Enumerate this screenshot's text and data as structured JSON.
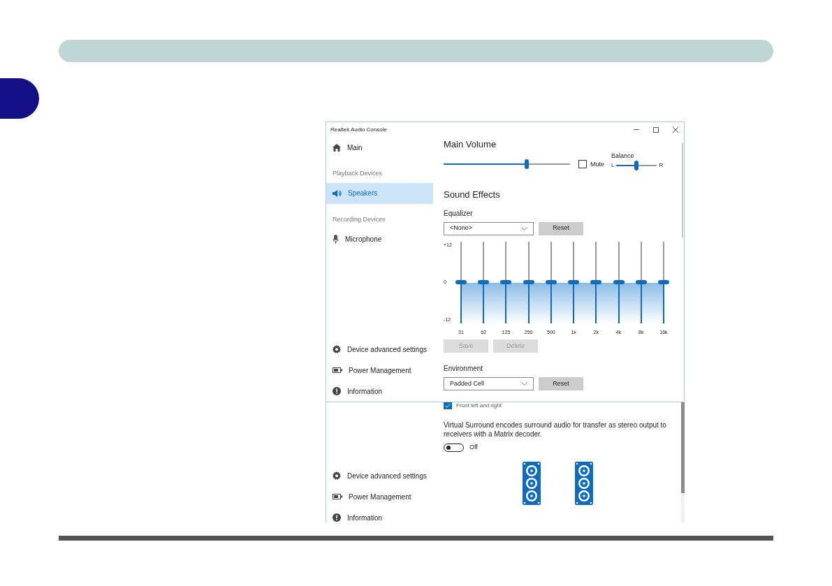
{
  "window": {
    "title": "Realtek Audio Console"
  },
  "sidebar": {
    "items": [
      {
        "kind": "nav",
        "label": "Main",
        "selected": false
      },
      {
        "kind": "header",
        "label": "Playback Devices"
      },
      {
        "kind": "nav",
        "label": "Speakers",
        "selected": true
      },
      {
        "kind": "header",
        "label": "Recording Devices"
      },
      {
        "kind": "nav",
        "label": "Microphone",
        "selected": false
      }
    ],
    "footer": [
      "Device advanced settings",
      "Power Management",
      "Information"
    ]
  },
  "main_volume": {
    "title": "Main Volume",
    "level": 0.66,
    "mute": {
      "label": "Mute",
      "checked": false
    },
    "balance": {
      "label": "Balance",
      "left": "L",
      "right": "R",
      "level": 0.5
    }
  },
  "sound_effects": {
    "title": "Sound Effects",
    "equalizer": {
      "label": "Equalizer",
      "preset": "<None>",
      "reset": "Reset",
      "scale": [
        "+12",
        "0",
        "-12"
      ],
      "bands": [
        {
          "label": "31",
          "level": 0.5
        },
        {
          "label": "62",
          "level": 0.5
        },
        {
          "label": "125",
          "level": 0.5
        },
        {
          "label": "250",
          "level": 0.5
        },
        {
          "label": "500",
          "level": 0.5
        },
        {
          "label": "1k",
          "level": 0.5
        },
        {
          "label": "2k",
          "level": 0.5
        },
        {
          "label": "4k",
          "level": 0.5
        },
        {
          "label": "8k",
          "level": 0.5
        },
        {
          "label": "16k",
          "level": 0.5
        }
      ],
      "save": {
        "label": "Save",
        "disabled": true
      },
      "delete": {
        "label": "Delete",
        "disabled": true
      }
    },
    "environment": {
      "label": "Environment",
      "value": "Padded Cell",
      "reset": "Reset"
    }
  },
  "lower_pane": {
    "front": {
      "label": "Front left and right",
      "checked": true
    },
    "description": "Virtual Surround encodes surround audio for transfer as stereo output to receivers with a Matrix decoder.",
    "toggle": {
      "on": false,
      "label": "Off"
    },
    "sidebar_footer": [
      "Device advanced settings",
      "Power Management",
      "Information"
    ]
  }
}
